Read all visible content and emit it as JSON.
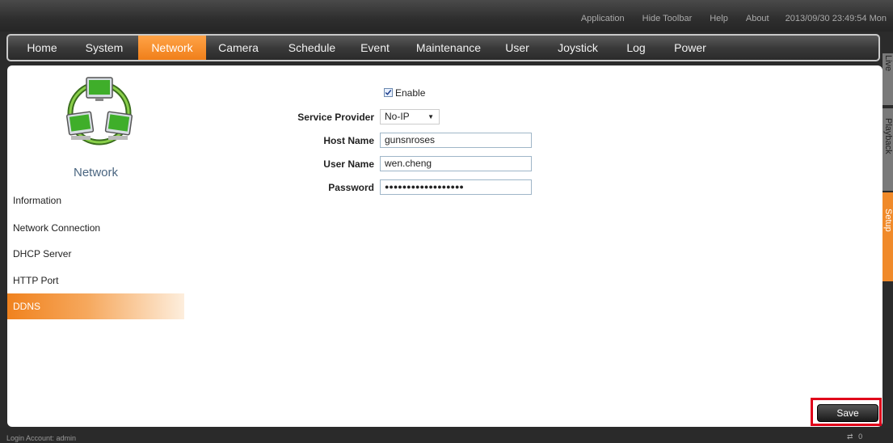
{
  "topbar": {
    "links": [
      "Application",
      "Hide Toolbar",
      "Help",
      "About"
    ],
    "datetime": "2013/09/30 23:49:54 Mon"
  },
  "nav": {
    "items": [
      "Home",
      "System",
      "Network",
      "Camera",
      "Schedule",
      "Event",
      "Maintenance",
      "User",
      "Joystick",
      "Log",
      "Power"
    ],
    "active": "Network"
  },
  "side_tabs": [
    "Live",
    "Playback",
    "Setup"
  ],
  "sidebar": {
    "title": "Network",
    "items": [
      "Information",
      "Network Connection",
      "DHCP Server",
      "HTTP Port",
      "DDNS"
    ],
    "active": "DDNS"
  },
  "form": {
    "enable_label": "Enable",
    "enable_checked": true,
    "service_provider_label": "Service Provider",
    "service_provider_value": "No-IP",
    "host_name_label": "Host Name",
    "host_name_value": "gunsnroses",
    "user_name_label": "User Name",
    "user_name_value": "wen.cheng",
    "password_label": "Password",
    "password_value": "●●●●●●●●●●●●●●●●●●"
  },
  "save_label": "Save",
  "status": {
    "login": "Login Account: admin",
    "connections": "0"
  },
  "colors": {
    "accent": "#f08a2a",
    "highlight_box": "#e0001a"
  }
}
